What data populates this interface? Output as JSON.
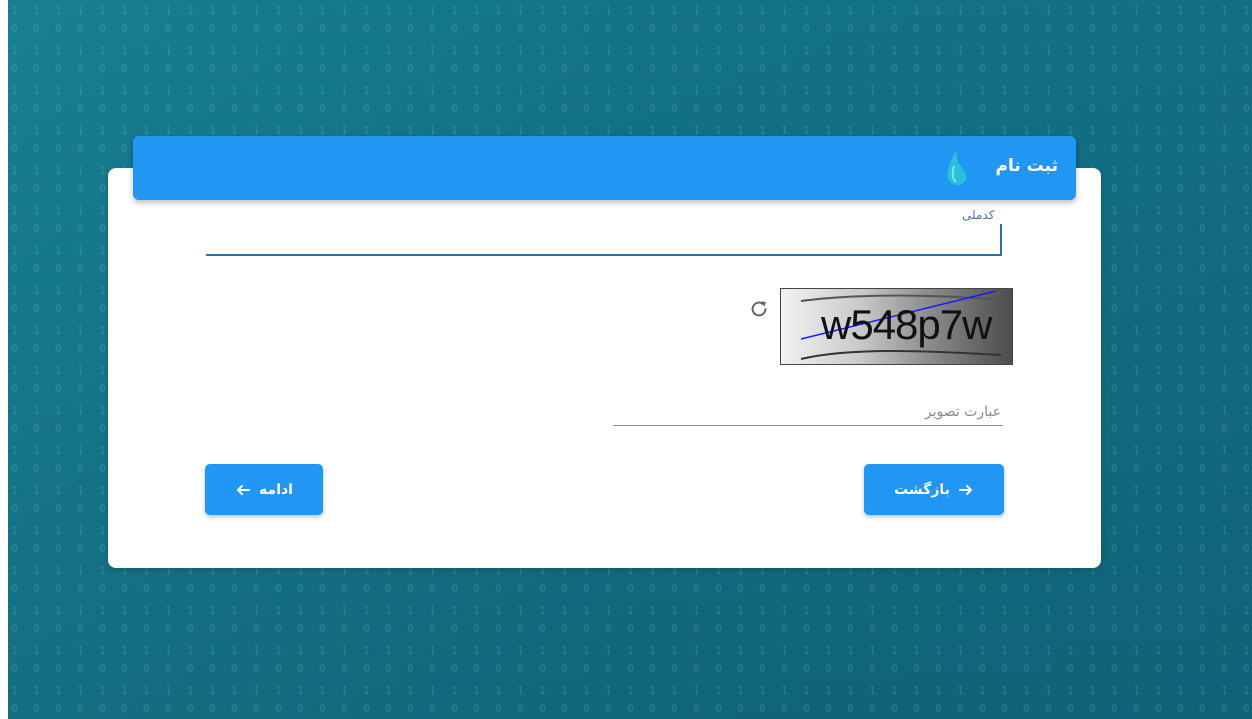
{
  "header": {
    "title": "ثبت نام",
    "logo_icon": "drop-logo-icon"
  },
  "national_code": {
    "label": "کدملی",
    "value": ""
  },
  "captcha": {
    "text": "w548p7w",
    "refresh_icon": "refresh-icon"
  },
  "phrase": {
    "placeholder": "عبارت تصویر",
    "value": ""
  },
  "actions": {
    "back_label": "بازگشت",
    "back_icon": "arrow-right-icon",
    "next_label": "ادامه",
    "next_icon": "arrow-left-icon"
  },
  "colors": {
    "primary": "#2196f3",
    "background": "#157789",
    "label": "#4d6fa6"
  }
}
